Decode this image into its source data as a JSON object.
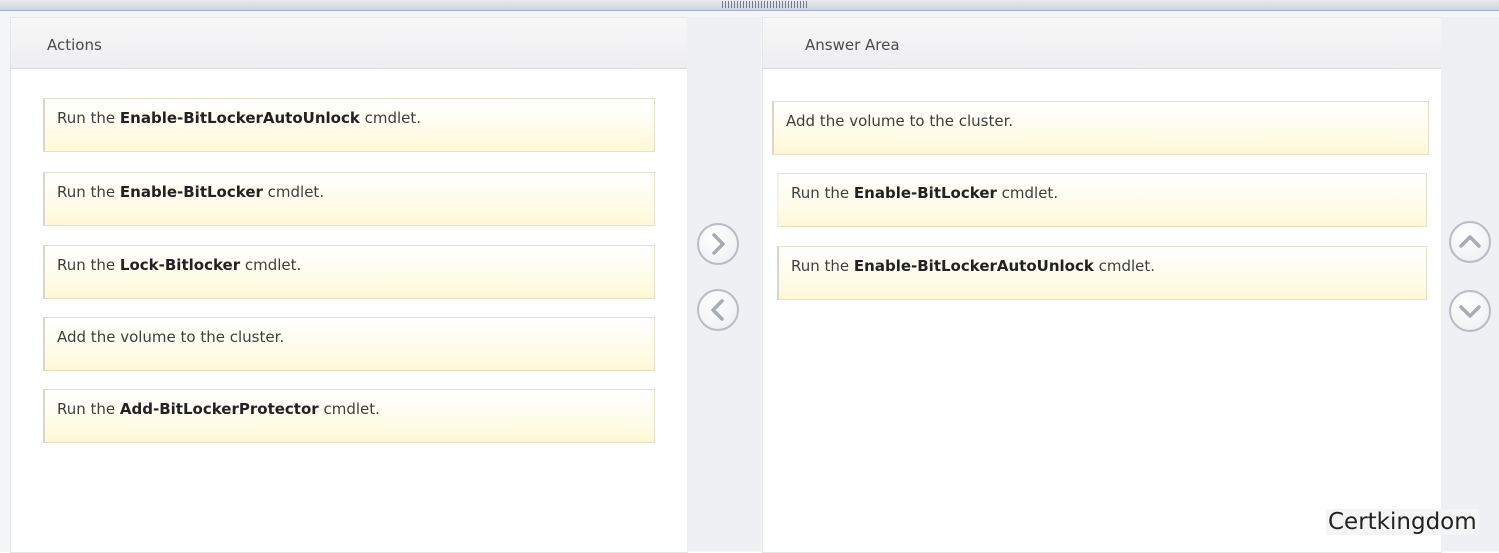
{
  "actions_panel": {
    "title": "Actions",
    "items": [
      {
        "prefix": "Run the ",
        "bold": "Enable-BitLockerAutoUnlock",
        "suffix": " cmdlet."
      },
      {
        "prefix": "Run the ",
        "bold": "Enable-BitLocker",
        "suffix": " cmdlet."
      },
      {
        "prefix": "Run the ",
        "bold": "Lock-Bitlocker",
        "suffix": " cmdlet."
      },
      {
        "prefix": "Add the volume to the cluster.",
        "bold": "",
        "suffix": ""
      },
      {
        "prefix": "Run the ",
        "bold": "Add-BitLockerProtector",
        "suffix": " cmdlet."
      }
    ]
  },
  "answer_panel": {
    "title": "Answer Area",
    "items": [
      {
        "prefix": "Add the volume to the cluster.",
        "bold": "",
        "suffix": ""
      },
      {
        "prefix": "Run the ",
        "bold": "Enable-BitLocker",
        "suffix": " cmdlet."
      },
      {
        "prefix": "Run the ",
        "bold": "Enable-BitLockerAutoUnlock",
        "suffix": " cmdlet."
      }
    ]
  },
  "controls": {
    "move_right_icon": "chevron-right-icon",
    "move_left_icon": "chevron-left-icon",
    "move_up_icon": "chevron-up-icon",
    "move_down_icon": "chevron-down-icon"
  },
  "watermark": "Certkingdom"
}
